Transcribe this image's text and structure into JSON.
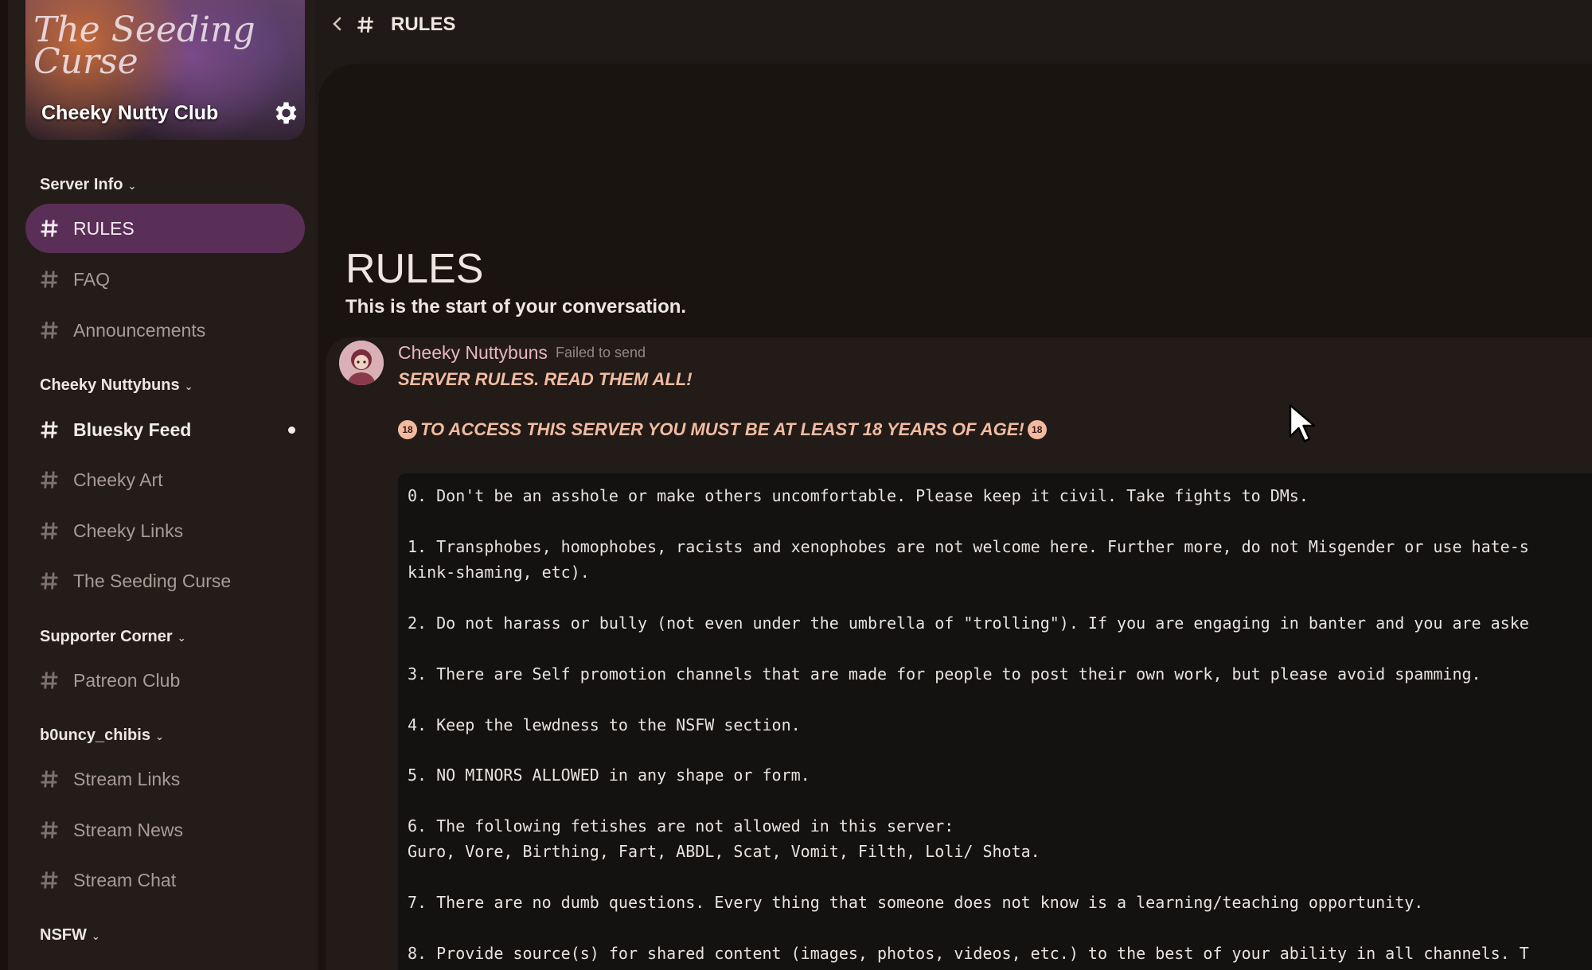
{
  "server": {
    "banner_art_title": "The Seeding Curse",
    "name": "Cheeky Nutty Club"
  },
  "sidebar": {
    "categories": [
      {
        "label": "Server Info",
        "chevron": "chevron-down-icon"
      },
      {
        "label": "Cheeky Nuttybuns",
        "chevron": "chevron-down-icon"
      },
      {
        "label": "Supporter Corner",
        "chevron": "chevron-down-icon"
      },
      {
        "label": "b0uncy_chibis",
        "chevron": "chevron-down-icon"
      },
      {
        "label": "NSFW",
        "chevron": "chevron-down-icon"
      }
    ],
    "channels": [
      {
        "label": "RULES",
        "active": true
      },
      {
        "label": "FAQ"
      },
      {
        "label": "Announcements"
      },
      {
        "label": "Bluesky Feed",
        "unread": true
      },
      {
        "label": "Cheeky Art"
      },
      {
        "label": "Cheeky Links"
      },
      {
        "label": "The Seeding Curse"
      },
      {
        "label": "Patreon Club"
      },
      {
        "label": "Stream Links"
      },
      {
        "label": "Stream News"
      },
      {
        "label": "Stream Chat"
      }
    ]
  },
  "header": {
    "channel_title": "RULES"
  },
  "main": {
    "heading": "RULES",
    "subheading": "This is the start of your conversation.",
    "message": {
      "author": "Cheeky Nuttybuns",
      "status": "Failed to send",
      "line1": "SERVER RULES. READ THEM ALL!",
      "line2": "TO ACCESS THIS SERVER YOU MUST BE AT LEAST 18 YEARS OF AGE!",
      "badge": "18",
      "rules": [
        "0. Don't be an asshole or make others uncomfortable. Please keep it civil. Take fights to DMs.",
        "1. Transphobes, homophobes, racists and xenophobes are not welcome here. Further more, do not Misgender or use hate-s",
        "kink-shaming, etc).",
        "2. Do not harass or bully (not even under the umbrella of \"trolling\"). If you are engaging in banter and you are aske",
        "3. There are Self promotion channels that are made for people to post their own work, but please avoid spamming.",
        "4. Keep the lewdness to the NSFW section.",
        "5. NO MINORS ALLOWED in any shape or form.",
        "6. The following fetishes are not allowed in this server:",
        "Guro, Vore, Birthing, Fart, ABDL, Scat, Vomit, Filth, Loli/ Shota.",
        "7. There are no dumb questions. Every thing that someone does not know is a learning/teaching opportunity.",
        "8. Provide source(s) for shared content (images, photos, videos, etc.) to the best of your ability in all channels. T"
      ]
    }
  },
  "colors": {
    "active_channel": "#5a2f57",
    "author": "#e8b7c0",
    "emphasis": "#f2bba0"
  }
}
